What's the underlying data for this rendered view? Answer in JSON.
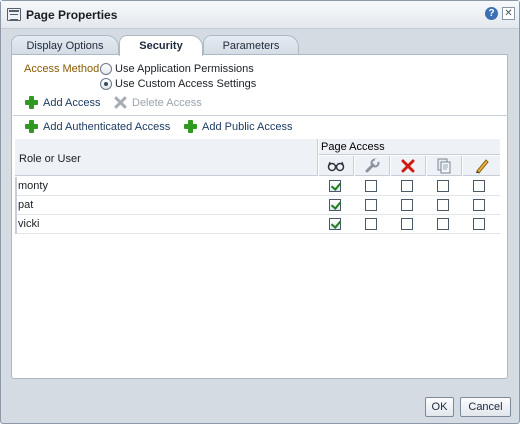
{
  "dialog": {
    "title": "Page Properties",
    "help_symbol": "?",
    "close_symbol": "✕"
  },
  "tabs": [
    {
      "label": "Display Options",
      "active": false
    },
    {
      "label": "Security",
      "active": true
    },
    {
      "label": "Parameters",
      "active": false
    }
  ],
  "access_method": {
    "label": "Access Method",
    "options": [
      {
        "label": "Use Application Permissions",
        "selected": false
      },
      {
        "label": "Use Custom Access Settings",
        "selected": true
      }
    ]
  },
  "toolbar": {
    "add_access": "Add Access",
    "delete_access": "Delete Access",
    "add_authenticated_access": "Add Authenticated Access",
    "add_public_access": "Add Public Access"
  },
  "grid": {
    "col_role": "Role or User",
    "col_page_access": "Page Access",
    "permission_icons": [
      "view-glasses-icon",
      "manage-wrench-icon",
      "delete-x-icon",
      "create-copy-icon",
      "edit-pencil-icon"
    ],
    "rows": [
      {
        "name": "monty",
        "perms": [
          true,
          false,
          false,
          false,
          false
        ]
      },
      {
        "name": "pat",
        "perms": [
          true,
          false,
          false,
          false,
          false
        ]
      },
      {
        "name": "vicki",
        "perms": [
          true,
          false,
          false,
          false,
          false
        ]
      }
    ]
  },
  "footer": {
    "ok": "OK",
    "cancel": "Cancel"
  },
  "colors": {
    "accent_label": "#8a5a00",
    "add_green": "#2f9a1f",
    "delete_red": "#d11a0f",
    "dialog_bg": "#d4dbe3"
  }
}
